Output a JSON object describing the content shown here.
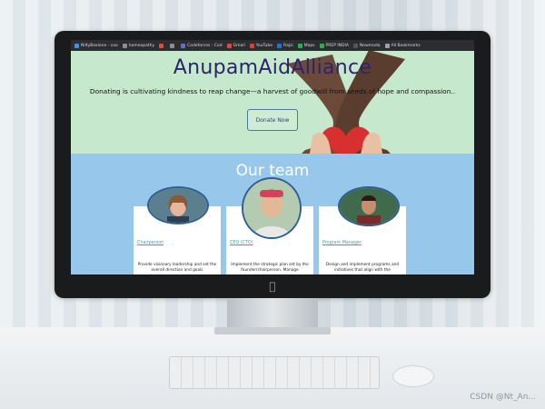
{
  "browser": {
    "tabs": [
      {
        "label": "NiltyBoxlone - coo",
        "color": "#4a90d9"
      },
      {
        "label": "homeopathy",
        "color": "#8e8e8e"
      },
      {
        "label": "",
        "color": "#e04b3a"
      },
      {
        "label": "",
        "color": "#8e8e8e"
      },
      {
        "label": "Codeforces - Cod",
        "color": "#6a6ad6"
      },
      {
        "label": "Gmail",
        "color": "#d94b3a"
      },
      {
        "label": "YouTube",
        "color": "#e53935"
      },
      {
        "label": "Rajsi",
        "color": "#1a73e8"
      },
      {
        "label": "Maps",
        "color": "#34a853"
      },
      {
        "label": "PREP INDIA",
        "color": "#34a853"
      },
      {
        "label": "Newmoda",
        "color": "#555555"
      },
      {
        "label": "All Bookmarks",
        "color": "#9aa0a6"
      }
    ]
  },
  "hero": {
    "title": "AnupamAidAlliance",
    "tagline": "Donating is cultivating kindness to reap change—a harvest of goodwill from seeds of hope and compassion..",
    "donate_label": "Donate Now"
  },
  "team": {
    "title": "Our team",
    "members": [
      {
        "role": "Chairperson",
        "description": "Provide visionary leadership and set the overall direction and goals"
      },
      {
        "role": "CEO (CTO)",
        "description": "Implement the strategic plan set by the founder/chairperson. Manage"
      },
      {
        "role": "Program Manager",
        "description": "Design and implement programs and initiatives that align with the"
      }
    ]
  },
  "photo": {
    "watermark": "CSDN @Nt_An..."
  }
}
